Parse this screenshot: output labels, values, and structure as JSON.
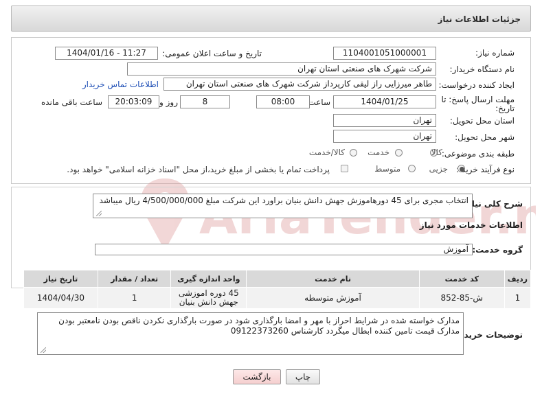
{
  "header": {
    "title": "جزئیات اطلاعات نیاز"
  },
  "form": {
    "need_number_label": "شماره نیاز:",
    "need_number": "1104001051000001",
    "announce_label": "تاریخ و ساعت اعلان عمومی:",
    "announce_value": "1404/01/16 - 11:27",
    "buyer_org_label": "نام دستگاه خریدار:",
    "buyer_org": "شرکت شهرک های صنعتی استان تهران",
    "requester_label": "ایجاد کننده درخواست:",
    "requester": "طاهر  میرزایی راز لیقی کارپرداز شرکت شهرک های صنعتی استان تهران",
    "contact_link": "اطلاعات تماس خریدار",
    "deadline_label_1": "مهلت ارسال پاسخ: تا",
    "deadline_label_2": "تاریخ:",
    "deadline_date": "1404/01/25",
    "time_label": "ساعت",
    "deadline_time": "08:00",
    "days_value": "8",
    "days_label": "روز و",
    "remaining_time": "20:03:09",
    "remaining_label": "ساعت باقی مانده",
    "province_label": "استان محل تحویل:",
    "province": "تهران",
    "city_label": "شهر محل تحویل:",
    "city": "تهران",
    "category_label": "طبقه بندی موضوعی:",
    "category_options": {
      "goods": "کالا",
      "service": "خدمت",
      "goods_service": "کالا/خدمت"
    },
    "process_label": "نوع فرآیند خرید :",
    "process_options": {
      "partial": "جزیی",
      "medium": "متوسط"
    },
    "payment_note": "پرداخت تمام یا بخشی از مبلغ خرید،از محل \"اسناد خزانه اسلامی\" خواهد بود."
  },
  "summary": {
    "label": "شرح کلی نیاز:",
    "text": "انتخاب مجری برای 45 دورهاموزش جهش دانش بنیان براورد این شرکت مبلغ 4/500/000/000 ریال میباشد"
  },
  "services": {
    "section_title": "اطلاعات خدمات مورد نیاز",
    "group_label": "گروه خدمت:",
    "group_value": "آموزش",
    "columns": [
      "ردیف",
      "کد خدمت",
      "نام خدمت",
      "واحد اندازه گیری",
      "تعداد / مقدار",
      "تاریخ نیاز"
    ],
    "rows": [
      {
        "row": "1",
        "code": "ش-85-852",
        "name": "آموزش متوسطه",
        "unit": "45 دوره اموزشی جهش دانش بنیان",
        "qty": "1",
        "date": "1404/04/30"
      }
    ]
  },
  "buyer_notes": {
    "label": "توضیحات خریدار:",
    "text": "مدارک خواسته شده  در شرایط احراز با مهر و امضا بارگذاری شود در صورت بارگذاری نکردن ناقص بودن نامعتبر بودن مدارک قیمت تامین کننده ابطال میگردد کارشناس 09122373260"
  },
  "buttons": {
    "print": "چاپ",
    "back": "بازگشت"
  },
  "watermark": {
    "text": "AriaTender.neT"
  },
  "colors": {
    "link": "#1f4fb6",
    "header_bg": "#dcdcdc",
    "table_header": "#d9d9d9",
    "watermark": "#e8b3b3"
  }
}
